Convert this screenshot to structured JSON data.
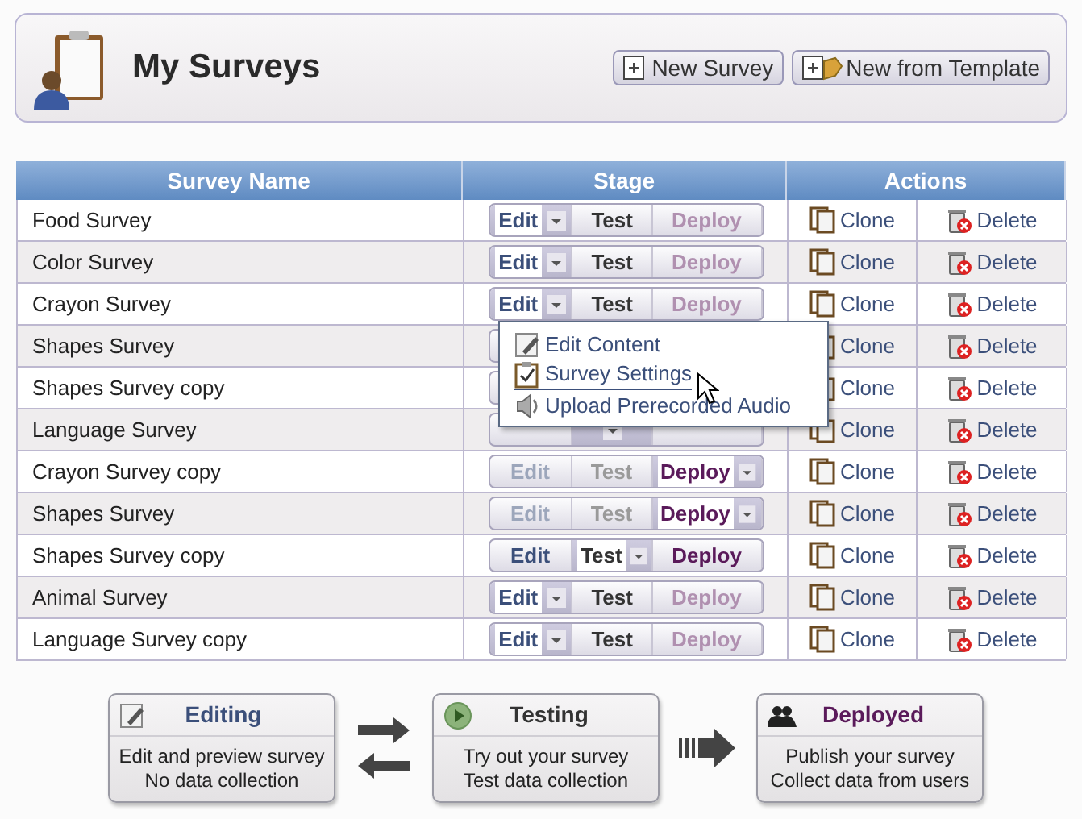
{
  "header": {
    "title": "My Surveys",
    "buttons": [
      "New Survey",
      "New from Template"
    ]
  },
  "table": {
    "columns": [
      "Survey Name",
      "Stage",
      "Actions"
    ],
    "rows": [
      {
        "name": "Food Survey",
        "stage_buttons": [
          {
            "label": "Edit",
            "kind": "active"
          },
          {
            "label": "Test",
            "kind": "normal"
          },
          {
            "label": "Deploy",
            "kind": "faded"
          }
        ],
        "clone": "Clone",
        "delete": "Delete"
      },
      {
        "name": "Color Survey",
        "stage_buttons": [
          {
            "label": "Edit",
            "kind": "active"
          },
          {
            "label": "Test",
            "kind": "normal"
          },
          {
            "label": "Deploy",
            "kind": "faded"
          }
        ],
        "clone": "Clone",
        "delete": "Delete"
      },
      {
        "name": "Crayon Survey",
        "stage_buttons": [
          {
            "label": "Edit",
            "kind": "active"
          },
          {
            "label": "Test",
            "kind": "normal"
          },
          {
            "label": "Deploy",
            "kind": "faded"
          }
        ],
        "clone": "Clone",
        "delete": "Delete"
      },
      {
        "name": "Shapes Survey",
        "clone": "Clone",
        "delete": "Delete"
      },
      {
        "name": "Shapes Survey copy",
        "clone": "Clone",
        "delete": "Delete"
      },
      {
        "name": "Language Survey",
        "stage_buttons": [
          {
            "kind": "normal"
          },
          {
            "kind": "active"
          },
          {
            "kind": "normal"
          }
        ],
        "clone": "Clone",
        "delete": "Delete"
      },
      {
        "name": "Crayon Survey copy",
        "stage_buttons": [
          {
            "label": "Edit",
            "kind": "faded"
          },
          {
            "label": "Test",
            "kind": "faded"
          },
          {
            "label": "Deploy",
            "kind": "active"
          }
        ],
        "clone": "Clone",
        "delete": "Delete"
      },
      {
        "name": "Shapes Survey",
        "stage_buttons": [
          {
            "label": "Edit",
            "kind": "faded"
          },
          {
            "label": "Test",
            "kind": "faded"
          },
          {
            "label": "Deploy",
            "kind": "active"
          }
        ],
        "clone": "Clone",
        "delete": "Delete"
      },
      {
        "name": "Shapes Survey copy",
        "stage_buttons": [
          {
            "label": "Edit",
            "kind": "normal"
          },
          {
            "label": "Test",
            "kind": "active"
          },
          {
            "label": "Deploy",
            "kind": "normal"
          }
        ],
        "clone": "Clone",
        "delete": "Delete"
      },
      {
        "name": "Animal Survey",
        "stage_buttons": [
          {
            "label": "Edit",
            "kind": "active"
          },
          {
            "label": "Test",
            "kind": "normal"
          },
          {
            "label": "Deploy",
            "kind": "faded"
          }
        ],
        "clone": "Clone",
        "delete": "Delete"
      },
      {
        "name": "Language Survey copy",
        "stage_buttons": [
          {
            "label": "Edit",
            "kind": "active"
          },
          {
            "label": "Test",
            "kind": "normal"
          },
          {
            "label": "Deploy",
            "kind": "faded"
          }
        ],
        "clone": "Clone",
        "delete": "Delete"
      }
    ]
  },
  "menu": {
    "items": [
      {
        "label": "Edit Content",
        "kind": "edit",
        "selected": false
      },
      {
        "label": "Survey Settings",
        "kind": "settings",
        "selected": true
      },
      {
        "label": "Upload Prerecorded Audio",
        "kind": "audio",
        "selected": false
      }
    ]
  },
  "workflow": [
    {
      "kind": "edit",
      "title": "Editing",
      "lines": [
        "Edit and preview survey",
        "No data collection"
      ]
    },
    {
      "kind": "test",
      "title": "Testing",
      "lines": [
        "Try out your survey",
        "Test data collection"
      ]
    },
    {
      "kind": "deploy",
      "title": "Deployed",
      "lines": [
        "Publish your survey",
        "Collect data from users"
      ]
    }
  ]
}
